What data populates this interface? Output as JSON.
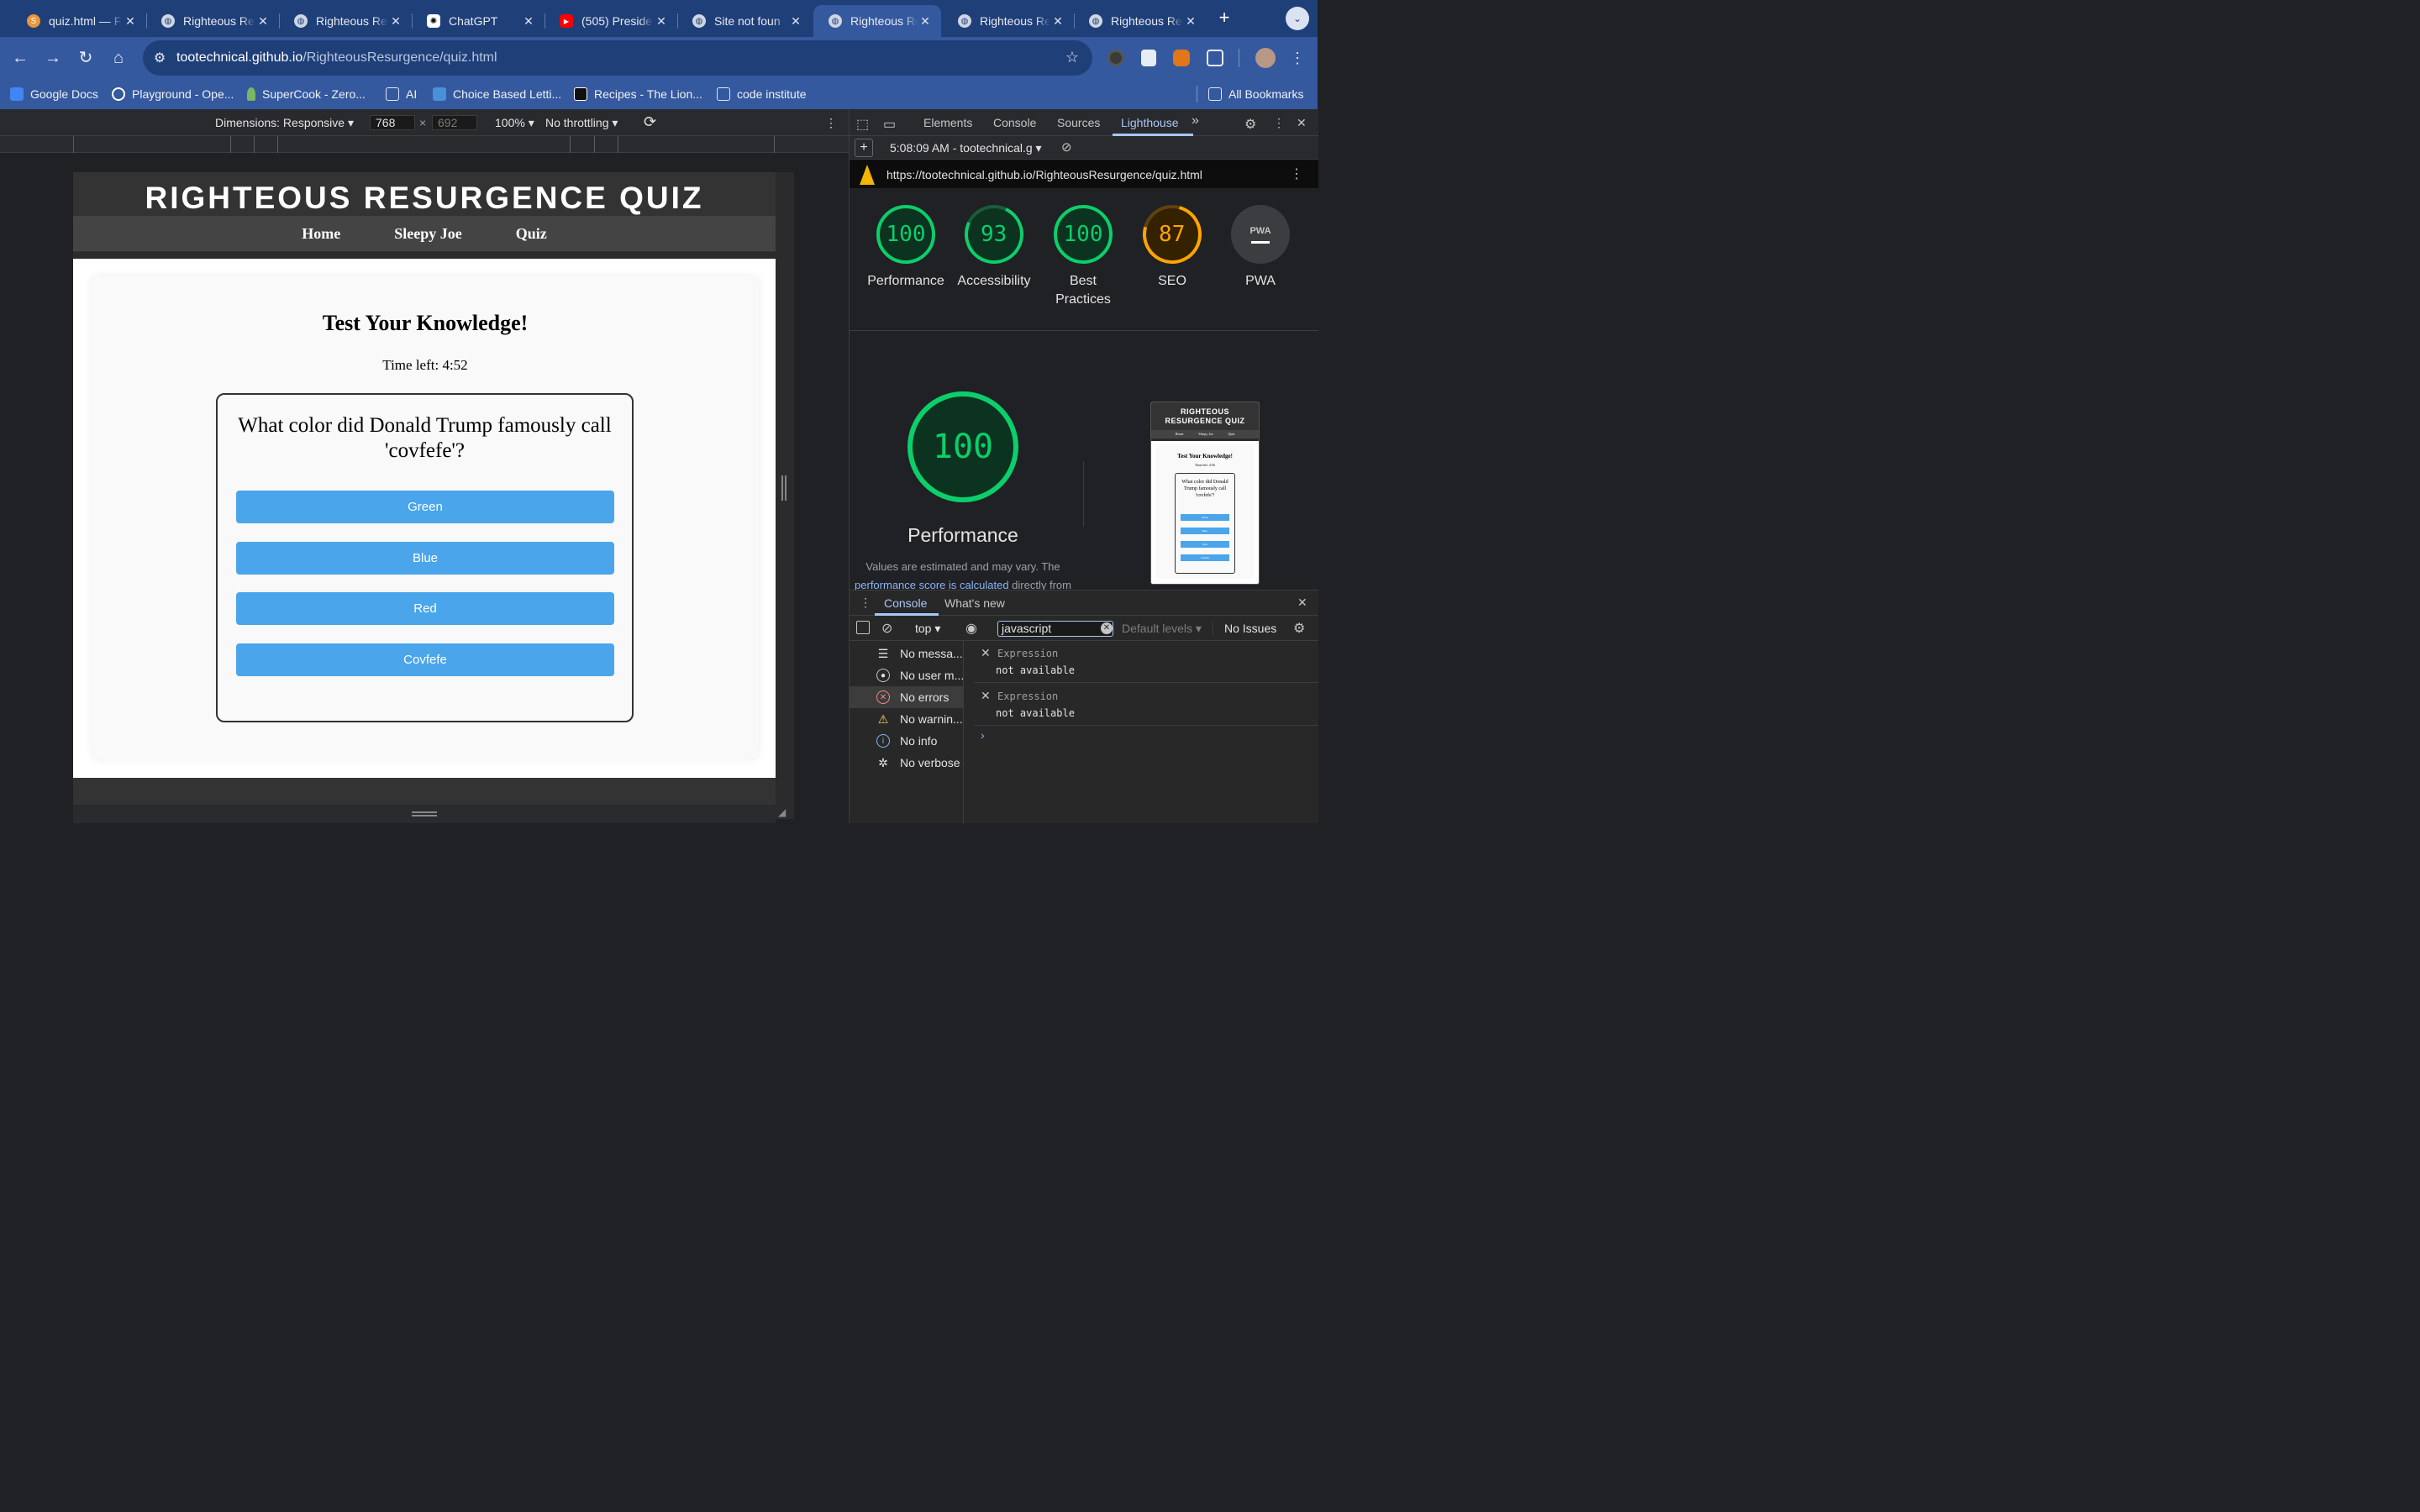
{
  "browser": {
    "tabs": [
      {
        "title": "quiz.html — F",
        "favicon": "sublime-icon"
      },
      {
        "title": "Righteous Re",
        "favicon": "globe-icon"
      },
      {
        "title": "Righteous Re",
        "favicon": "globe-icon"
      },
      {
        "title": "ChatGPT",
        "favicon": "chatgpt-icon"
      },
      {
        "title": "(505) Preside",
        "favicon": "youtube-icon"
      },
      {
        "title": "Site not foun",
        "favicon": "globe-icon"
      },
      {
        "title": "Righteous Re",
        "favicon": "globe-icon",
        "active": true
      },
      {
        "title": "Righteous Re",
        "favicon": "globe-icon"
      },
      {
        "title": "Righteous Re",
        "favicon": "globe-icon"
      }
    ],
    "new_tab": "+",
    "url_host": "tootechnical.github.io",
    "url_path": "/RighteousResurgence/quiz.html",
    "bookmarks": [
      "Google Docs",
      "Playground - Ope...",
      "SuperCook - Zero...",
      "AI",
      "Choice Based Letti...",
      "Recipes - The Lion...",
      "code institute"
    ],
    "all_bookmarks": "All Bookmarks"
  },
  "device_toolbar": {
    "dimensions": "Dimensions: Responsive",
    "width": "768",
    "height": "692",
    "zoom": "100%",
    "throttling": "No throttling"
  },
  "site": {
    "title": "RIGHTEOUS RESURGENCE QUIZ",
    "nav": [
      "Home",
      "Sleepy Joe",
      "Quiz"
    ],
    "quiz_title": "Test Your Knowledge!",
    "timer": "Time left: 4:52",
    "question": "What color did Donald Trump famously call 'covfefe'?",
    "answers": [
      "Green",
      "Blue",
      "Red",
      "Covfefe"
    ]
  },
  "devtools": {
    "tabs": [
      "Elements",
      "Console",
      "Sources",
      "Lighthouse"
    ],
    "active_tab": "Lighthouse",
    "more_tabs": "»",
    "report_time": "5:08:09 AM - tootechnical.g",
    "report_url": "https://tootechnical.github.io/RighteousResurgence/quiz.html",
    "scores": [
      {
        "label": "Performance",
        "value": "100",
        "color": "#0cce6b"
      },
      {
        "label": "Accessibility",
        "value": "93",
        "color": "#0cce6b"
      },
      {
        "label": "Best Practices",
        "value": "100",
        "color": "#0cce6b"
      },
      {
        "label": "SEO",
        "value": "87",
        "color": "#ffa400"
      },
      {
        "label": "PWA",
        "value": "PWA",
        "color": "#9aa0a6"
      }
    ],
    "main_score": "100",
    "main_label": "Performance",
    "note_text": "Values are estimated and may vary. The",
    "note_link": "performance score is calculated",
    "note_tail": " directly from",
    "thumbnail": {
      "title": "RIGHTEOUS RESURGENCE QUIZ",
      "nav": [
        "Home",
        "Sleepy Joe",
        "Quiz"
      ],
      "quiz_title": "Test Your Knowledge!",
      "timer": "Time left: 4:56",
      "question": "What color did Donald Trump famously call 'covfefe'?",
      "answers": [
        "Green",
        "Blue",
        "Red",
        "Covfefe"
      ]
    },
    "drawer": {
      "tabs": [
        "Console",
        "What's new"
      ],
      "context": "top",
      "filter": "javascript",
      "levels": "Default levels",
      "issues": "No Issues",
      "sidebar": [
        {
          "label": "No messa...",
          "icon": "list-icon"
        },
        {
          "label": "No user m...",
          "icon": "user-icon"
        },
        {
          "label": "No errors",
          "icon": "error-icon",
          "selected": true
        },
        {
          "label": "No warnin...",
          "icon": "warning-icon"
        },
        {
          "label": "No info",
          "icon": "info-icon"
        },
        {
          "label": "No verbose",
          "icon": "bug-icon"
        }
      ],
      "expressions": [
        {
          "key": "Expression",
          "value": "not available"
        },
        {
          "key": "Expression",
          "value": "not available"
        }
      ],
      "prompt": "›"
    }
  }
}
